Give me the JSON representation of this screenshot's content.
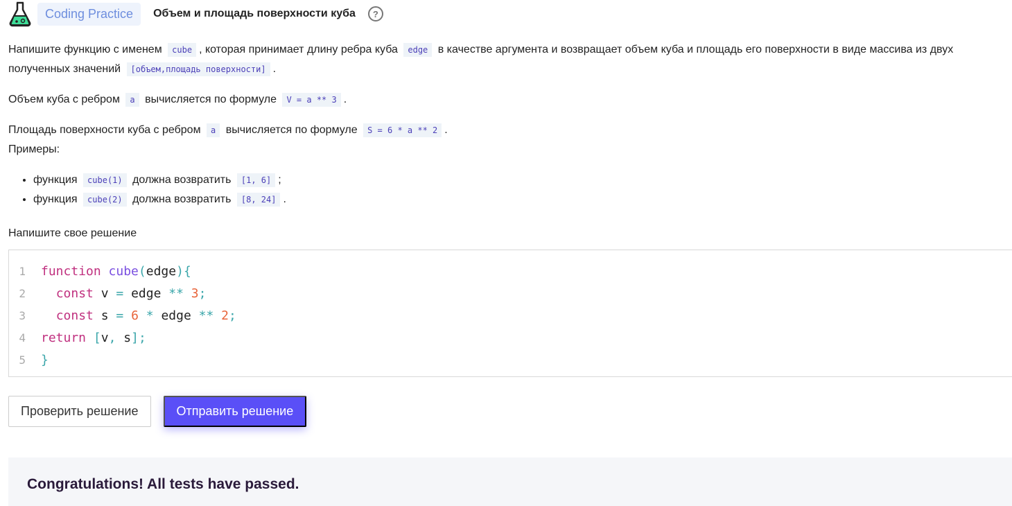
{
  "header": {
    "badge": "Coding Practice",
    "title": "Объем и площадь поверхности куба",
    "help": "?"
  },
  "desc": {
    "p1": [
      "Напишите функцию с именем",
      "cube",
      ", которая принимает длину ребра куба",
      "edge",
      "в качестве аргумента и возвращает объем куба и площадь его поверхности в виде массива из двух полученных значений",
      "[объем,площадь поверхности]",
      "."
    ],
    "p2": [
      "Объем куба с ребром",
      "a",
      "вычисляется по формуле",
      "V = a ** 3",
      "."
    ],
    "p3": [
      "Площадь поверхности куба с ребром",
      "a",
      "вычисляется по формуле",
      "S = 6 * a ** 2",
      "."
    ],
    "examples_label": "Примеры:",
    "examples": [
      [
        "функция",
        "cube(1)",
        "должна возвратить",
        "[1, 6]",
        ";"
      ],
      [
        "функция",
        "cube(2)",
        "должна возвратить",
        "[8, 24]",
        "."
      ]
    ]
  },
  "solution_label": "Напишите свое решение",
  "code": [
    {
      "n": "1",
      "tokens": [
        [
          "kw",
          "function"
        ],
        [
          "t",
          " "
        ],
        [
          "fn",
          "cube"
        ],
        [
          "p",
          "("
        ],
        [
          "t",
          "edge"
        ],
        [
          "p",
          ")"
        ],
        [
          "p",
          "{"
        ]
      ]
    },
    {
      "n": "2",
      "tokens": [
        [
          "t",
          "  "
        ],
        [
          "kw",
          "const"
        ],
        [
          "t",
          " v "
        ],
        [
          "p",
          "="
        ],
        [
          "t",
          " edge "
        ],
        [
          "p",
          "**"
        ],
        [
          "t",
          " "
        ],
        [
          "num",
          "3"
        ],
        [
          "p",
          ";"
        ]
      ]
    },
    {
      "n": "3",
      "tokens": [
        [
          "t",
          "  "
        ],
        [
          "kw",
          "const"
        ],
        [
          "t",
          " s "
        ],
        [
          "p",
          "="
        ],
        [
          "t",
          " "
        ],
        [
          "num",
          "6"
        ],
        [
          "t",
          " "
        ],
        [
          "p",
          "*"
        ],
        [
          "t",
          " edge "
        ],
        [
          "p",
          "**"
        ],
        [
          "t",
          " "
        ],
        [
          "num",
          "2"
        ],
        [
          "p",
          ";"
        ]
      ]
    },
    {
      "n": "4",
      "tokens": [
        [
          "kw",
          "return"
        ],
        [
          "t",
          " "
        ],
        [
          "p",
          "["
        ],
        [
          "t",
          "v"
        ],
        [
          "p",
          ","
        ],
        [
          "t",
          " s"
        ],
        [
          "p",
          "]"
        ],
        [
          "p",
          ";"
        ]
      ]
    },
    {
      "n": "5",
      "tokens": [
        [
          "p",
          "}"
        ]
      ]
    }
  ],
  "syntax_colors": {
    "kw": "#c0307f",
    "fn": "#7a4fe0",
    "p": "#3aa6aa",
    "num": "#e8643a",
    "t": "#222222"
  },
  "buttons": {
    "check": "Проверить решение",
    "submit": "Отправить решение"
  },
  "result": {
    "message": "Congratulations! All tests have passed."
  }
}
